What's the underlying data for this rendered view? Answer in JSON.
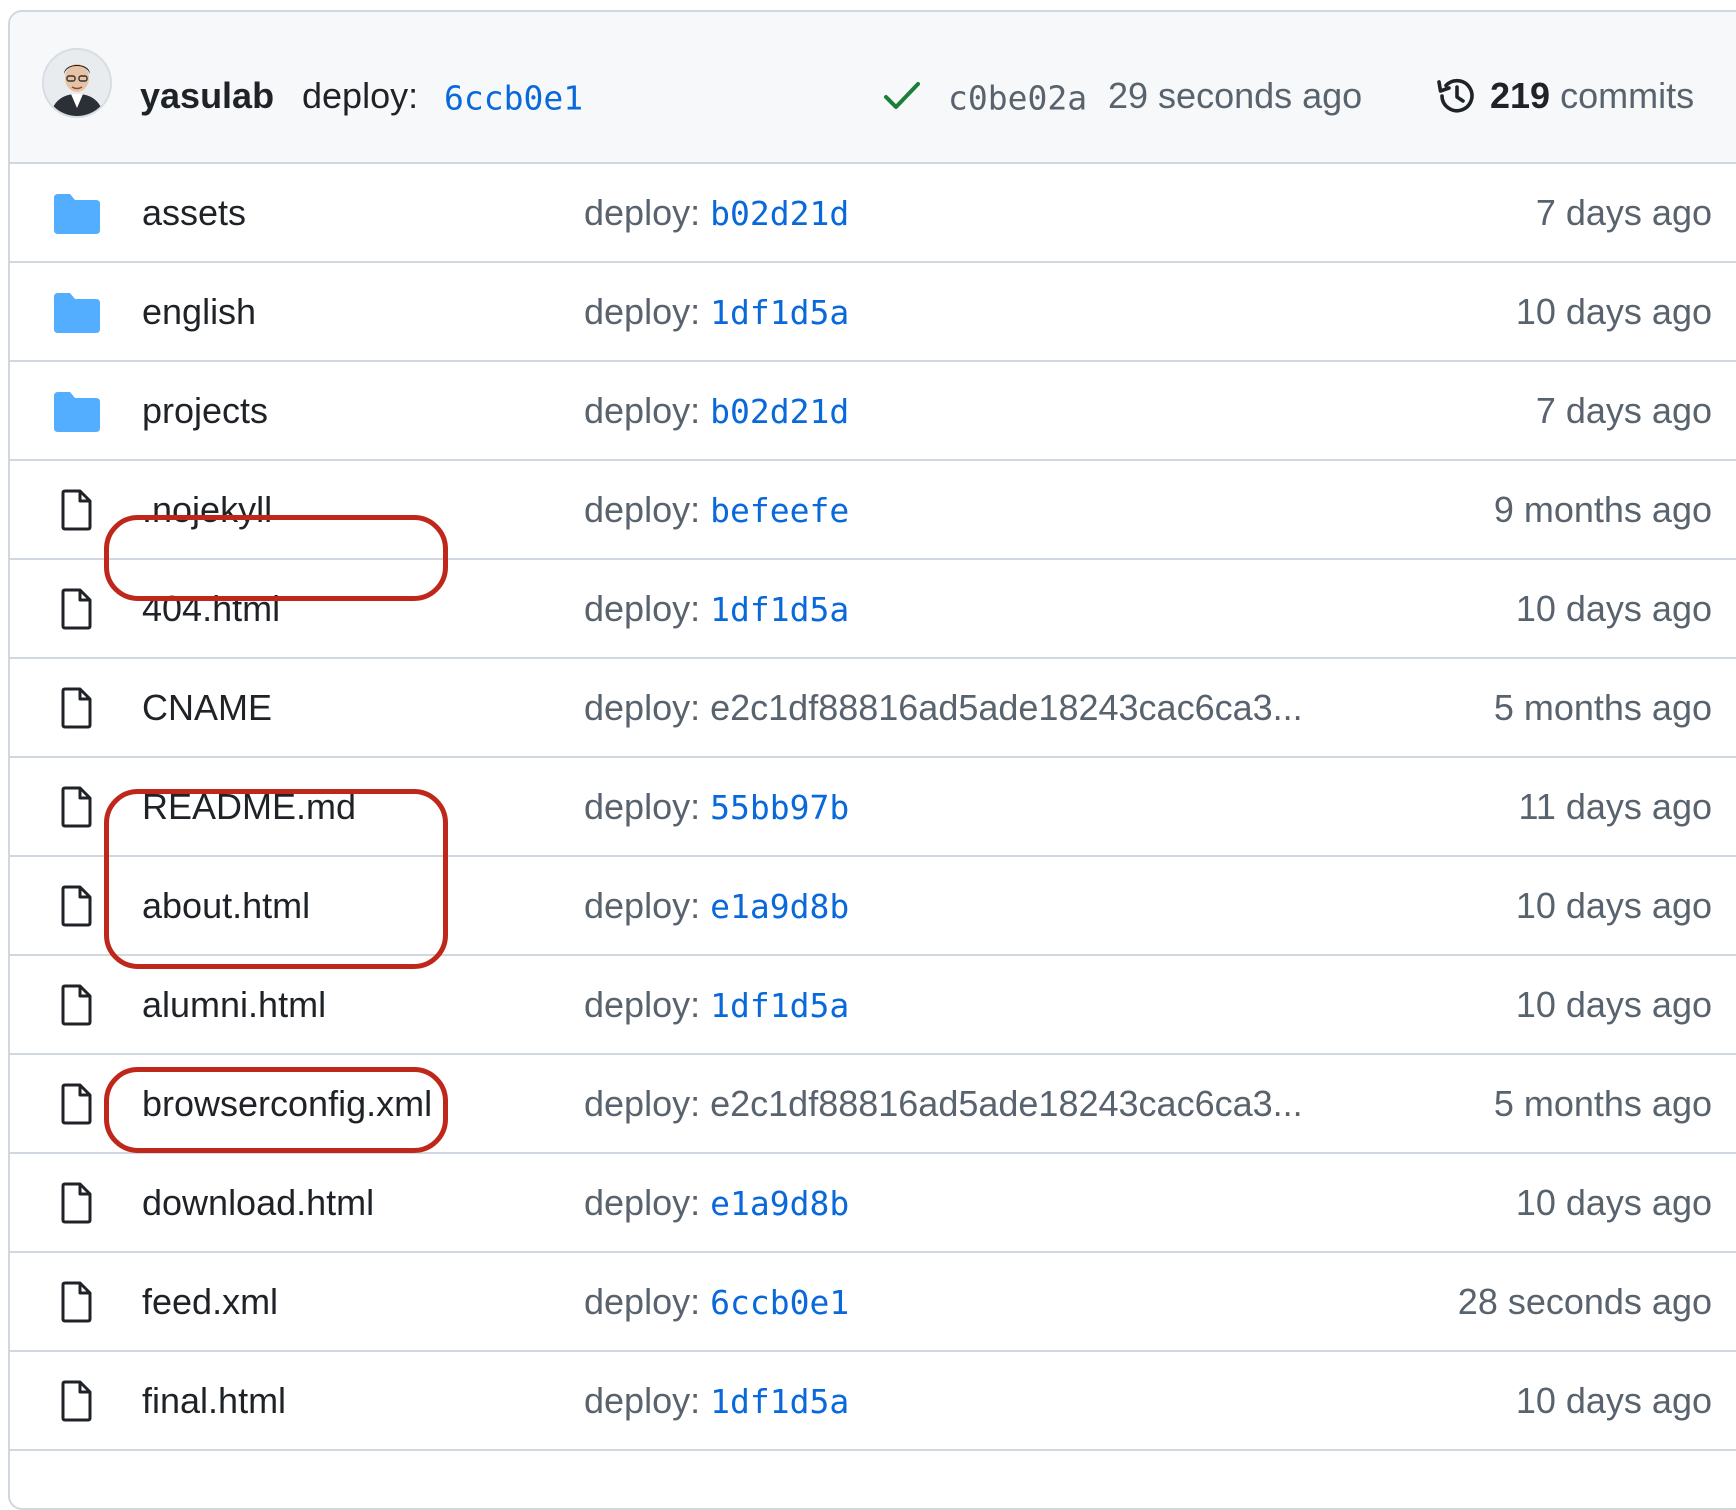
{
  "header": {
    "author": "yasulab",
    "message": "deploy:",
    "message_hash": "6ccb0e1",
    "status": "success",
    "sha": "c0be02a",
    "time": "29 seconds ago",
    "commits_count": "219",
    "commits_label": "commits"
  },
  "colors": {
    "link": "#0969da",
    "muted": "#59636e",
    "folder": "#54aeff",
    "success": "#1a7f37",
    "highlight": "#c0271b"
  },
  "files": [
    {
      "icon": "folder-icon",
      "name": "assets",
      "msg": "deploy:",
      "hash": "b02d21d",
      "date": "7 days ago"
    },
    {
      "icon": "folder-icon",
      "name": "english",
      "msg": "deploy:",
      "hash": "1df1d5a",
      "date": "10 days ago"
    },
    {
      "icon": "folder-icon",
      "name": "projects",
      "msg": "deploy:",
      "hash": "b02d21d",
      "date": "7 days ago"
    },
    {
      "icon": "file-icon",
      "name": ".nojekyll",
      "msg": "deploy:",
      "hash": "befeefe",
      "date": "9 months ago"
    },
    {
      "icon": "file-icon",
      "name": "404.html",
      "msg": "deploy:",
      "hash": "1df1d5a",
      "date": "10 days ago"
    },
    {
      "icon": "file-icon",
      "name": "CNAME",
      "msg": "deploy:",
      "long": "e2c1df88816ad5ade18243cac6ca3...",
      "date": "5 months ago"
    },
    {
      "icon": "file-icon",
      "name": "README.md",
      "msg": "deploy:",
      "hash": "55bb97b",
      "date": "11 days ago"
    },
    {
      "icon": "file-icon",
      "name": "about.html",
      "msg": "deploy:",
      "hash": "e1a9d8b",
      "date": "10 days ago"
    },
    {
      "icon": "file-icon",
      "name": "alumni.html",
      "msg": "deploy:",
      "hash": "1df1d5a",
      "date": "10 days ago"
    },
    {
      "icon": "file-icon",
      "name": "browserconfig.xml",
      "msg": "deploy:",
      "long": "e2c1df88816ad5ade18243cac6ca3...",
      "date": "5 months ago"
    },
    {
      "icon": "file-icon",
      "name": "download.html",
      "msg": "deploy:",
      "hash": "e1a9d8b",
      "date": "10 days ago"
    },
    {
      "icon": "file-icon",
      "name": "feed.xml",
      "msg": "deploy:",
      "hash": "6ccb0e1",
      "date": "28 seconds ago"
    },
    {
      "icon": "file-icon",
      "name": "final.html",
      "msg": "deploy:",
      "hash": "1df1d5a",
      "date": "10 days ago"
    }
  ],
  "highlighted_files": [
    "404.html",
    "about.html",
    "alumni.html",
    "download.html"
  ]
}
